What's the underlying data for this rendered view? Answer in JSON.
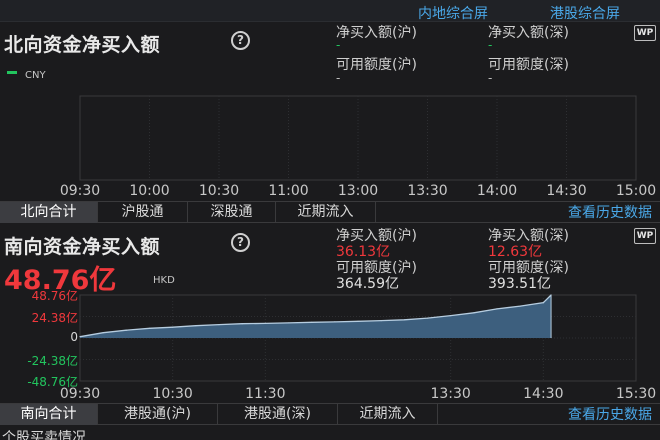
{
  "top_links": {
    "mainland": "内地综合屏",
    "hk": "港股综合屏"
  },
  "north": {
    "title": "北向资金净买入额",
    "help_icon": "?",
    "currency": "CNY",
    "sh_net_label": "净买入额(沪)",
    "sh_net_value": "-",
    "sz_net_label": "净买入额(深)",
    "sz_net_value": "-",
    "sh_quota_label": "可用额度(沪)",
    "sh_quota_value": "-",
    "sz_quota_label": "可用额度(深)",
    "sz_quota_value": "-",
    "wp_icon": "WP",
    "x_ticks": [
      "09:30",
      "10:00",
      "10:30",
      "11:00",
      "13:00",
      "13:30",
      "14:00",
      "14:30",
      "15:00"
    ],
    "tabs": [
      "北向合计",
      "沪股通",
      "深股通",
      "近期流入"
    ],
    "history_link": "查看历史数据",
    "accent_color": "#22c55e"
  },
  "south": {
    "title": "南向资金净买入额",
    "help_icon": "?",
    "total_value": "48.76亿",
    "currency": "HKD",
    "sh_net_label": "净买入额(沪)",
    "sh_net_value": "36.13亿",
    "sz_net_label": "净买入额(深)",
    "sz_net_value": "12.63亿",
    "sh_quota_label": "可用额度(沪)",
    "sh_quota_value": "364.59亿",
    "sz_quota_label": "可用额度(深)",
    "sz_quota_value": "393.51亿",
    "wp_icon": "WP",
    "tabs": [
      "南向合计",
      "港股通(沪)",
      "港股通(深)",
      "近期流入"
    ],
    "history_link": "查看历史数据",
    "value_color": "#f0383c"
  },
  "chart_data": {
    "type": "area",
    "title": "南向资金净买入额",
    "x_ticks": [
      "09:30",
      "10:30",
      "11:30",
      "13:30",
      "14:30",
      "15:30"
    ],
    "y_ticks": [
      "48.76亿",
      "24.38亿",
      "0",
      "-24.38亿",
      "-48.76亿"
    ],
    "ylim": [
      -48.76,
      48.76
    ],
    "x": [
      "09:30",
      "09:45",
      "10:00",
      "10:15",
      "10:30",
      "10:45",
      "11:00",
      "11:15",
      "11:30",
      "11:45",
      "12:00",
      "12:15",
      "12:30",
      "12:45",
      "13:00",
      "13:15",
      "13:30",
      "13:45",
      "14:00",
      "14:15",
      "14:30",
      "14:35"
    ],
    "values": [
      1.5,
      6.0,
      8.8,
      11.0,
      12.2,
      14.0,
      15.2,
      16.2,
      16.6,
      17.1,
      17.8,
      18.3,
      18.9,
      19.7,
      20.6,
      22.6,
      25.4,
      28.6,
      33.0,
      36.2,
      40.0,
      48.76
    ],
    "fill_color": "#3d5f7e",
    "line_color": "#b6cde0",
    "grid": true
  },
  "footer_section": "个股买卖情况"
}
